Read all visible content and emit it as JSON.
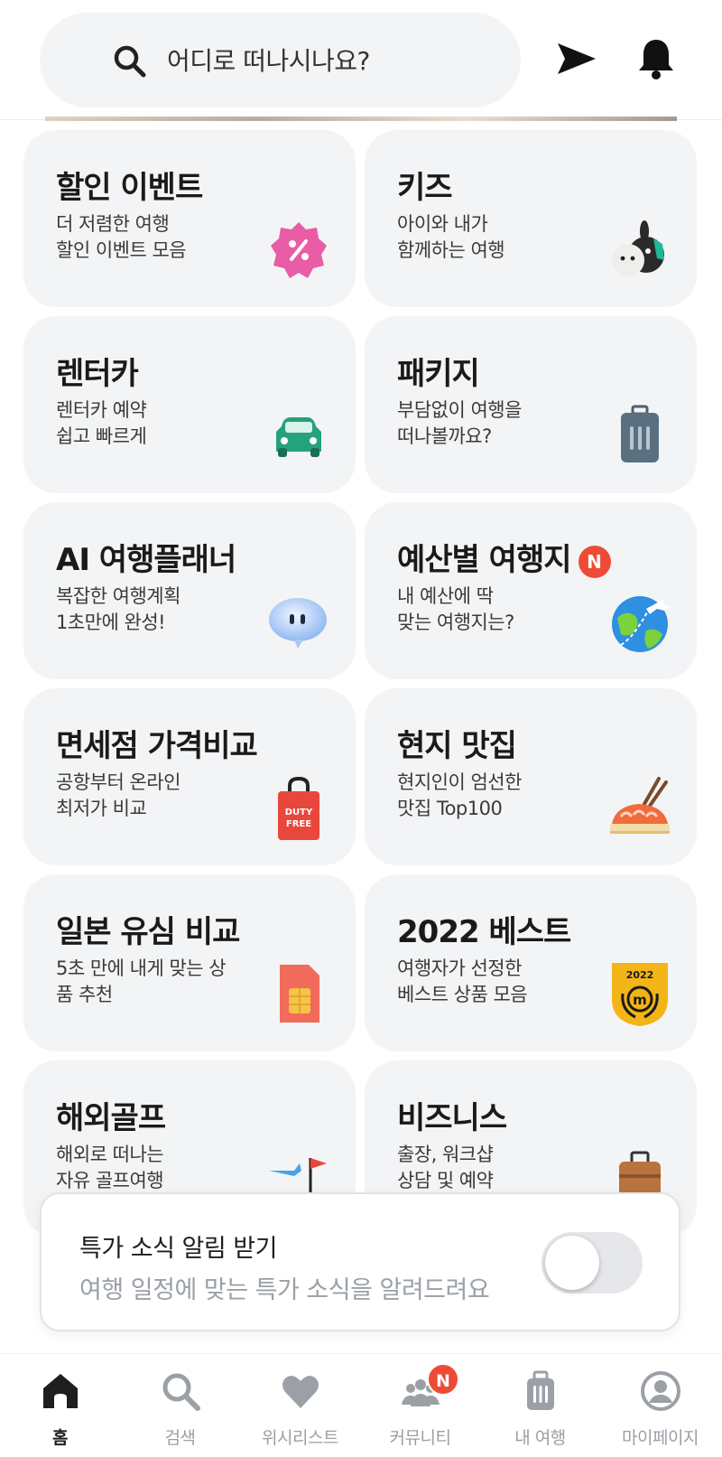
{
  "search": {
    "placeholder": "어디로 떠나시나요?"
  },
  "header": {
    "send_icon": "send-icon",
    "bell_icon": "bell-icon"
  },
  "cards": [
    {
      "title": "할인 이벤트",
      "sub1": "더 저렴한 여행",
      "sub2": "할인 이벤트 모음",
      "icon": "discount-icon"
    },
    {
      "title": "키즈",
      "sub1": "아이와 내가",
      "sub2": "함께하는 여행",
      "icon": "kids-icon"
    },
    {
      "title": "렌터카",
      "sub1": "렌터카 예약",
      "sub2": "쉽고 빠르게",
      "icon": "car-icon"
    },
    {
      "title": "패키지",
      "sub1": "부담없이 여행을",
      "sub2": "떠나볼까요?",
      "icon": "suitcase-icon"
    },
    {
      "title": "AI 여행플래너",
      "sub1": "복잡한 여행계획",
      "sub2": "1초만에 완성!",
      "icon": "chat-bubble-icon"
    },
    {
      "title": "예산별 여행지",
      "badge": "N",
      "sub1": "내 예산에 딱",
      "sub2": "맞는 여행지는?",
      "icon": "globe-plane-icon"
    },
    {
      "title": "면세점 가격비교",
      "sub1": "공항부터 온라인",
      "sub2": "최저가 비교",
      "icon": "duty-free-bag-icon",
      "icon_text": "DUTY FREE"
    },
    {
      "title": "현지 맛집",
      "sub1": "현지인이 엄선한",
      "sub2": "맛집 Top100",
      "icon": "sushi-icon"
    },
    {
      "title": "일본 유심 비교",
      "sub1": "5초 만에 내게 맞는 상",
      "sub2": "품 추천",
      "icon": "sim-card-icon"
    },
    {
      "title": "2022 베스트",
      "sub1": "여행자가 선정한",
      "sub2": "베스트 상품 모음",
      "icon": "best-medal-icon",
      "icon_text": "2022"
    },
    {
      "title": "해외골프",
      "sub1": "해외로 떠나는",
      "sub2": "자유 골프여행",
      "icon": "golf-icon"
    },
    {
      "title": "비즈니스",
      "sub1": "출장, 워크샵",
      "sub2": "상담 및 예약",
      "icon": "briefcase-icon"
    }
  ],
  "notify": {
    "title": "특가 소식 알림 받기",
    "description": "여행 일정에 맞는 특가 소식을 알려드려요",
    "toggle_on": false
  },
  "nav": [
    {
      "label": "홈",
      "icon": "home-icon",
      "active": true
    },
    {
      "label": "검색",
      "icon": "search-icon"
    },
    {
      "label": "위시리스트",
      "icon": "heart-icon"
    },
    {
      "label": "커뮤니티",
      "icon": "community-icon",
      "badge": "N"
    },
    {
      "label": "내 여행",
      "icon": "luggage-icon"
    },
    {
      "label": "마이페이지",
      "icon": "profile-icon"
    }
  ],
  "colors": {
    "card_bg": "#f3f4f6",
    "badge": "#ee4b36",
    "nav_active": "#1e1e1e",
    "nav_inactive": "#9aa0a6"
  }
}
